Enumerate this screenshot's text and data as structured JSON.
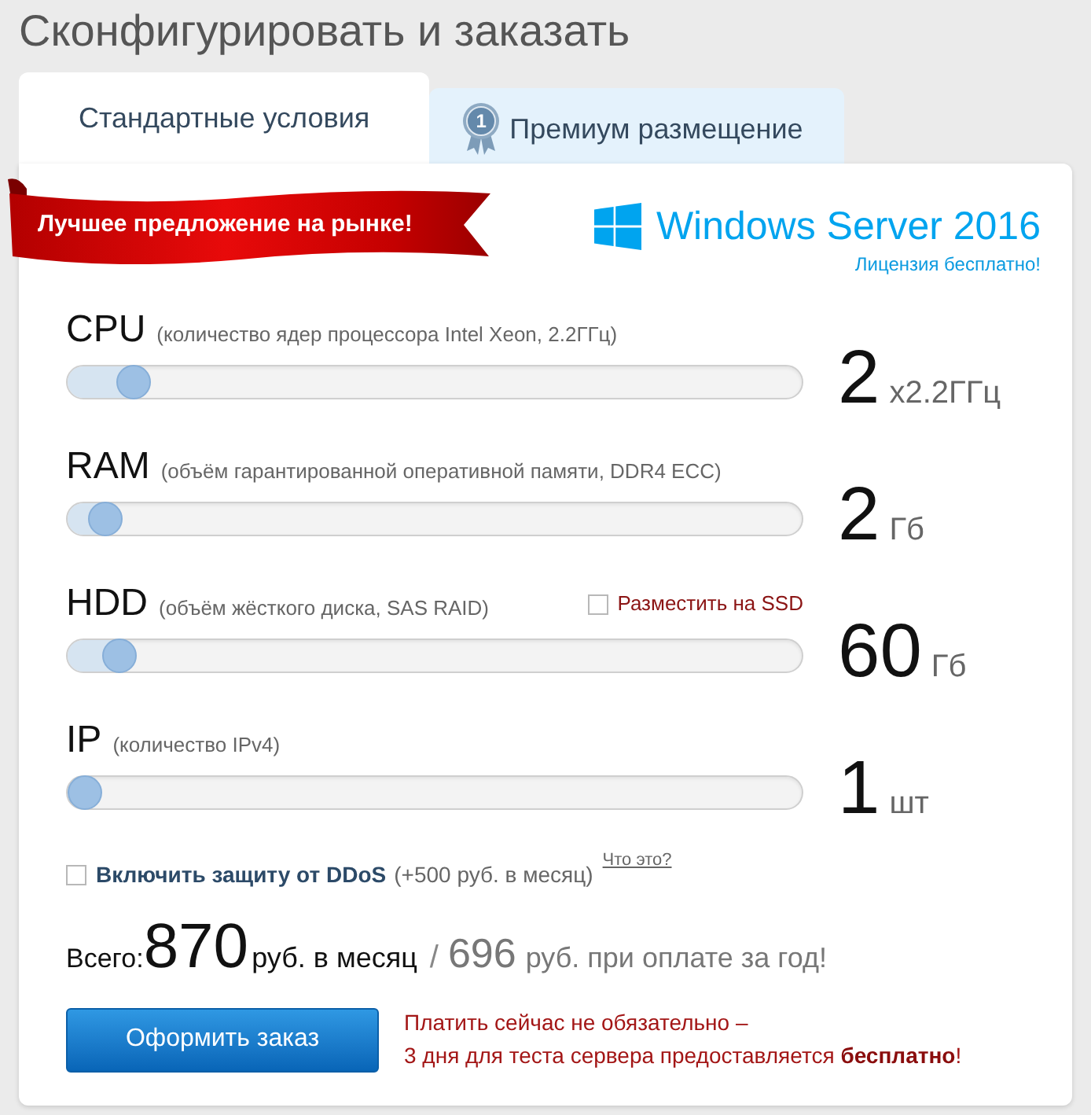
{
  "page_title": "Сконфигурировать и заказать",
  "tabs": [
    {
      "label": "Стандартные условия",
      "selected": true
    },
    {
      "label": "Премиум размещение",
      "selected": false,
      "badge": "1"
    }
  ],
  "promo_ribbon": "Лучшее предложение на рынке!",
  "product": {
    "name": "Windows Server 2016",
    "note": "Лицензия бесплатно!"
  },
  "sliders": [
    {
      "name": "CPU",
      "description": "(количество ядер процессора Intel Xeon, 2.2ГГц)",
      "level": 0.07,
      "value": "2",
      "unit": "x2.2ГГц"
    },
    {
      "name": "RAM",
      "description": "(объём гарантированной оперативной памяти, DDR4 ECC)",
      "level": 0.03,
      "value": "2",
      "unit": "Гб"
    },
    {
      "name": "HDD",
      "description": "(объём жёсткого диска, SAS RAID)",
      "option": {
        "label": "Разместить на SSD",
        "checked": false
      },
      "level": 0.05,
      "value": "60",
      "unit": "Гб"
    },
    {
      "name": "IP",
      "description": "(количество IPv4)",
      "level": 0,
      "value": "1",
      "unit": "шт"
    }
  ],
  "ddos": {
    "checked": false,
    "label": "Включить защиту от DDoS",
    "price": "(+500 руб. в месяц)",
    "link": "Что это?"
  },
  "total": {
    "label": "Всего:",
    "amount": "870",
    "period": "руб. в месяц",
    "separator": "/",
    "year_amount": "696",
    "year_period": "руб. при оплате за год!"
  },
  "order_button": "Оформить заказ",
  "note": [
    "Платить сейчас не обязательно –",
    "3 дня для теста сервера предоставляется **бесплатно**!"
  ]
}
